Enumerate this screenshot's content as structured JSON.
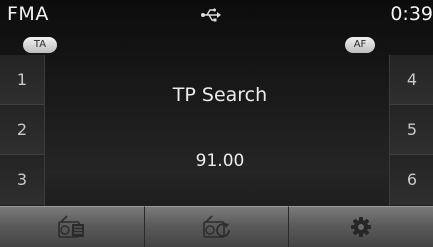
{
  "status": {
    "band": "FMA",
    "time": "0:39",
    "usb_icon": "usb-icon"
  },
  "badges": {
    "ta": "TA",
    "af": "AF"
  },
  "presets": {
    "left": [
      "1",
      "2",
      "3"
    ],
    "right": [
      "4",
      "5",
      "6"
    ]
  },
  "main": {
    "message": "TP Search",
    "frequency": "91.00"
  },
  "bottom_bar": {
    "buttons": [
      {
        "icon": "radio-list-icon"
      },
      {
        "icon": "radio-scan-icon"
      },
      {
        "icon": "gear-icon"
      }
    ]
  },
  "colors": {
    "screen_bg": "#1a1a1a",
    "text": "#ececec",
    "bottom_bar": "#666666"
  }
}
